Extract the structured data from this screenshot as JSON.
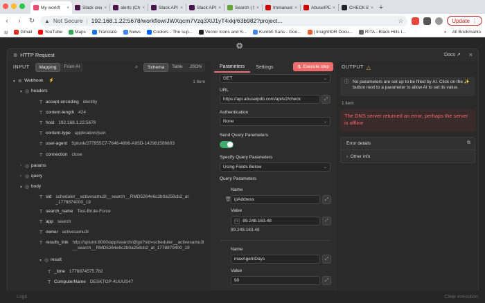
{
  "browser": {
    "tabs": [
      {
        "label": "My workfl",
        "color": "#ea4b71",
        "active": true
      },
      {
        "label": "Slack credentiel",
        "color": "#4a154b"
      },
      {
        "label": "alerts (Channel)",
        "color": "#4a154b"
      },
      {
        "label": "Slack API: Appl",
        "color": "#4a154b"
      },
      {
        "label": "Slack API: Appl",
        "color": "#4a154b"
      },
      {
        "label": "Search | Splunk",
        "color": "#65a637"
      },
      {
        "label": "Immanuel Samu",
        "color": "#c00"
      },
      {
        "label": "AbuseIPDB - IP",
        "color": "#c00"
      },
      {
        "label": "CHECK Endpoi",
        "color": "#222"
      }
    ],
    "new_tab": "+",
    "security": "Not Secure",
    "url": "192.168.1.22:5678/workflow/JWXqcm7Vzq3XlJ1yT4xkj/63b982?project...",
    "update_label": "Update",
    "bookmarks": [
      {
        "label": "Gmail",
        "color": "#d93025"
      },
      {
        "label": "YouTube",
        "color": "#ff0000"
      },
      {
        "label": "Maps",
        "color": "#34a853"
      },
      {
        "label": "Translate",
        "color": "#1a73e8"
      },
      {
        "label": "News",
        "color": "#4285f4"
      },
      {
        "label": "Coolors - The sup...",
        "color": "#0066ff"
      },
      {
        "label": "Vector Icons and S...",
        "color": "#222"
      },
      {
        "label": "Kumbh Sans - Goo...",
        "color": "#4285f4"
      },
      {
        "label": "| InsightIDR Docu...",
        "color": "#e85d2f"
      },
      {
        "label": "RITA - Black Hills I...",
        "color": "#666"
      }
    ],
    "all_bookmarks": "All Bookmarks"
  },
  "modal": {
    "title": "HTTP Request",
    "docs": "Docs",
    "close": "×"
  },
  "input": {
    "title": "INPUT",
    "modes": [
      "Mapping",
      "From AI"
    ],
    "views": [
      "Schema",
      "Table",
      "JSON"
    ],
    "item_count": "1 item",
    "rows": [
      {
        "depth": 0,
        "type": "node",
        "chev": "▾",
        "key": "Webhook",
        "flash": "⚡"
      },
      {
        "depth": 1,
        "type": "obj",
        "chev": "▾",
        "key": "headers"
      },
      {
        "depth": 2,
        "type": "str",
        "key": "accept-encoding",
        "val": "identity"
      },
      {
        "depth": 2,
        "type": "str",
        "key": "content-length",
        "val": "424"
      },
      {
        "depth": 2,
        "type": "str",
        "key": "host",
        "val": "192.168.1.22:5678"
      },
      {
        "depth": 2,
        "type": "str",
        "key": "content-type",
        "val": "application/json"
      },
      {
        "depth": 2,
        "type": "str",
        "key": "user-agent",
        "val": "Splunk/277955C7-7646-4896-A95D-142981586603"
      },
      {
        "depth": 2,
        "type": "str",
        "key": "connection",
        "val": "close"
      },
      {
        "depth": 1,
        "type": "obj",
        "chev": "›",
        "key": "params"
      },
      {
        "depth": 1,
        "type": "obj",
        "chev": "›",
        "key": "query"
      },
      {
        "depth": 1,
        "type": "obj",
        "chev": "▾",
        "key": "body"
      },
      {
        "depth": 2,
        "type": "str",
        "key": "sid",
        "val": "scheduler__activesamu3l__search__RMD5264e6c2b0a258cb2_at_1778874000_19",
        "multi": true
      },
      {
        "depth": 2,
        "type": "str",
        "key": "search_name",
        "val": "Test-Brute-Force"
      },
      {
        "depth": 2,
        "type": "str",
        "key": "app",
        "val": "search"
      },
      {
        "depth": 2,
        "type": "str",
        "key": "owner",
        "val": "activesamu3l"
      },
      {
        "depth": 2,
        "type": "str",
        "key": "results_link",
        "val": "http://splunk:8000/app/search/@go?sid=scheduler__activesamu3l__search__RMD5264e6c2b0a258cb2_at_1778879400_19",
        "multi": true
      },
      {
        "depth": 2,
        "type": "obj",
        "chev": "▾",
        "key": "result"
      },
      {
        "depth": 3,
        "type": "str",
        "key": "_time",
        "val": "1778874575.782"
      },
      {
        "depth": 3,
        "type": "str",
        "key": "ComputerName",
        "val": "DESKTOP-4UUUS47"
      }
    ]
  },
  "parameters": {
    "tabs": [
      "Parameters",
      "Settings"
    ],
    "execute_label": "Execute step",
    "method_value": "GET",
    "url_label": "URL",
    "url_value": "https://api.abuseipdb.com/api/v2/check",
    "auth_label": "Authentication",
    "auth_value": "None",
    "send_query_label": "Send Query Parameters",
    "send_query_on": true,
    "specify_label": "Specify Query Parameters",
    "specify_value": "Using Fields Below",
    "query_params_label": "Query Parameters",
    "q1": {
      "name_label": "Name",
      "name_value": "ipAddress",
      "value_label": "Value",
      "value_expr": "89.248.163.48",
      "value_preview": "89.248.163.48"
    },
    "q2": {
      "name_label": "Name",
      "name_value": "maxAgeInDays",
      "value_label": "Value",
      "value_value": "90"
    }
  },
  "output": {
    "title": "OUTPUT",
    "info": "No parameters are set up to be filled by AI. Click on the ✨ button next to a parameter to allow AI to set its value.",
    "item_count": "1 item",
    "error_message": "The DNS server returned an error, perhaps the server is offline",
    "error_details_label": "Error details",
    "other_info_label": "Other info"
  },
  "footer": {
    "logs": "Logs",
    "clear": "Clear execution"
  }
}
